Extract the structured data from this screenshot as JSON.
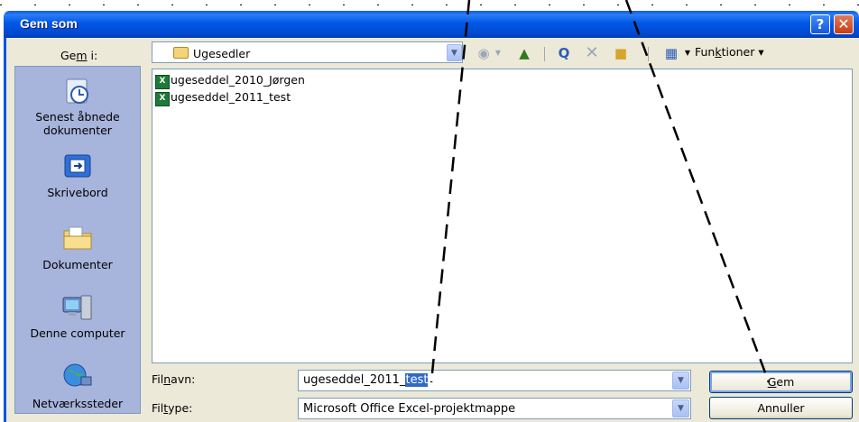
{
  "window": {
    "title": "Gem som",
    "help_label": "?",
    "close_label": "✕"
  },
  "location": {
    "label_pre": "Ge",
    "label_ul": "m",
    "label_post": " i:",
    "value": "Ugesedler"
  },
  "toolbar": {
    "tools_pre": "Fun",
    "tools_ul": "k",
    "tools_post": "tioner ▾"
  },
  "places": {
    "recent_line1": "Senest åbnede",
    "recent_line2": "dokumenter",
    "desktop": "Skrivebord",
    "documents": "Dokumenter",
    "computer": "Denne computer",
    "network": "Netværkssteder"
  },
  "files": [
    {
      "name": "ugeseddel_2010_Jørgen",
      "icon": "excel-icon"
    },
    {
      "name": "ugeseddel_2011_test",
      "icon": "excel-icon"
    }
  ],
  "filename": {
    "label_pre": "Fil",
    "label_ul": "n",
    "label_post": "avn:",
    "value_plain": "ugeseddel_2011_",
    "value_selected": "test"
  },
  "filetype": {
    "label_pre": "Fil",
    "label_ul": "t",
    "label_post": "ype:",
    "value": "Microsoft Office Excel-projektmappe"
  },
  "buttons": {
    "save_ul": "G",
    "save_post": "em",
    "cancel": "Annuller"
  }
}
